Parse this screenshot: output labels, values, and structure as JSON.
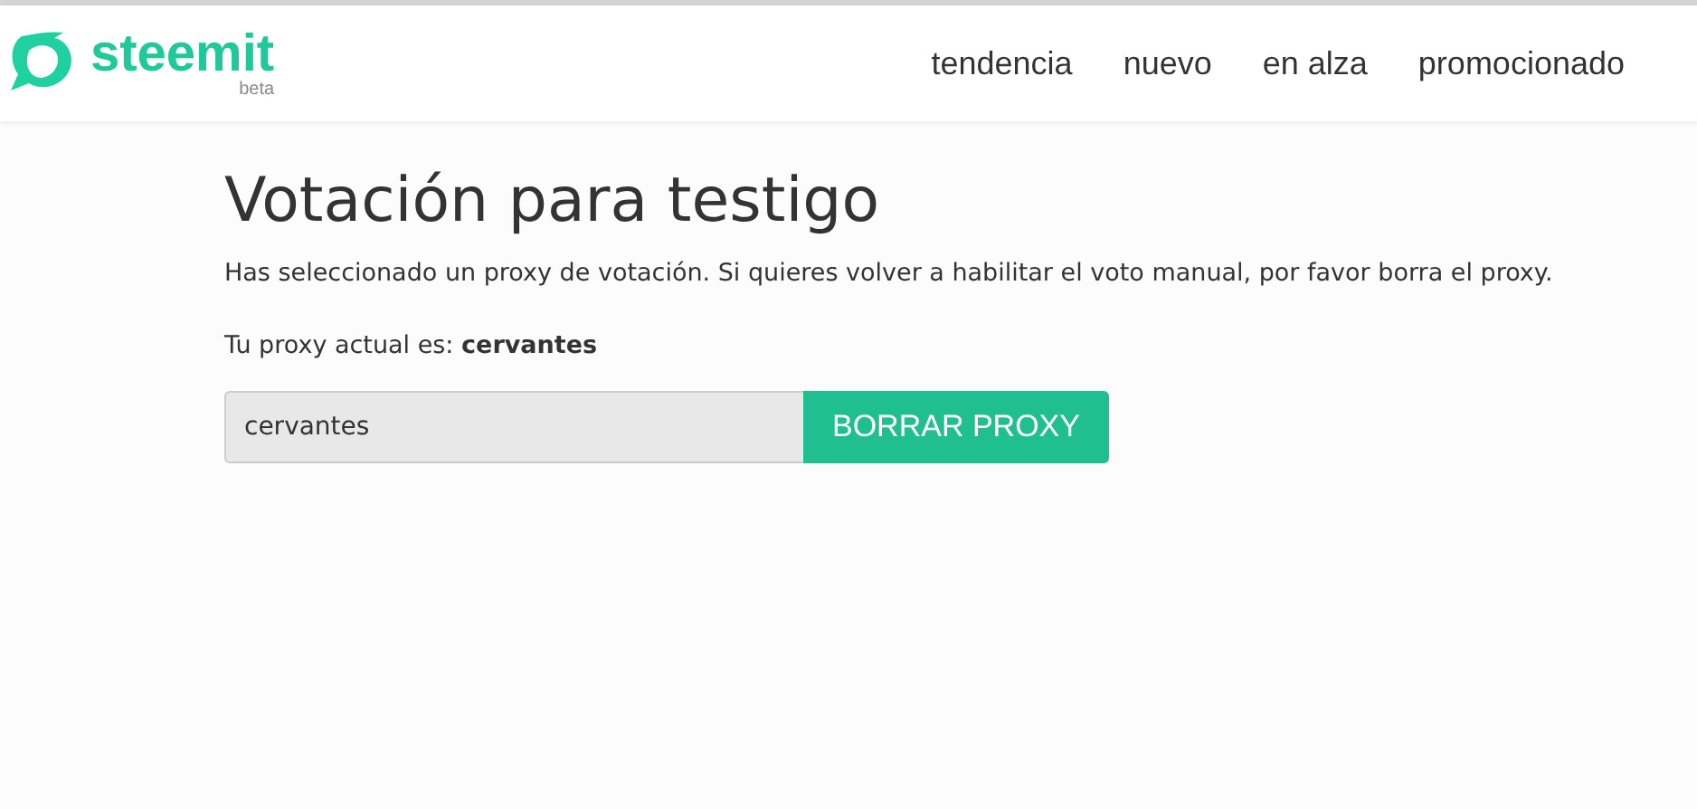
{
  "header": {
    "logo": {
      "name": "steemit",
      "tag": "beta"
    },
    "nav": [
      {
        "label": "tendencia"
      },
      {
        "label": "nuevo"
      },
      {
        "label": "en alza"
      },
      {
        "label": "promocionado"
      }
    ]
  },
  "page": {
    "title": "Votación para testigo",
    "notice": "Has seleccionado un proxy de votación. Si quieres volver a habilitar el voto manual, por favor borra el proxy.",
    "current_proxy": "Tu proxy actual es: **cervantes**",
    "proxy_field": {
      "value": "cervantes",
      "disabled": true
    },
    "button": "BORRAR PROXY"
  }
}
